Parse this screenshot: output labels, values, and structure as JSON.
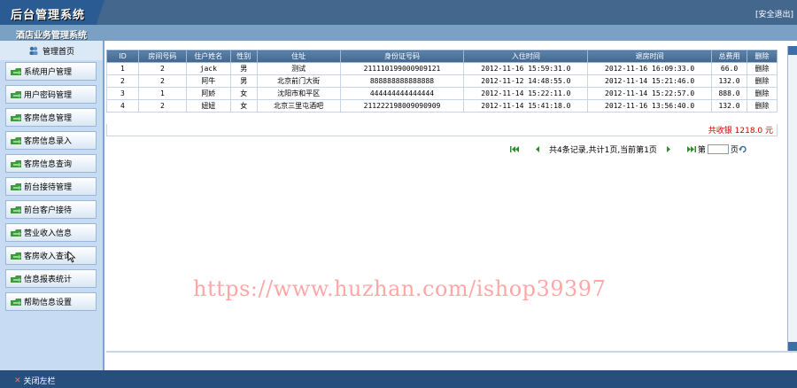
{
  "header": {
    "app_title": "后台管理系统",
    "logout": "[安全退出]",
    "subtitle": "酒店业务管理系统"
  },
  "sidebar": {
    "home": "管理首页",
    "items": [
      {
        "label": "系统用户管理"
      },
      {
        "label": "用户密码管理"
      },
      {
        "label": "客房信息管理"
      },
      {
        "label": "客房信息录入"
      },
      {
        "label": "客房信息查询"
      },
      {
        "label": "前台接待管理"
      },
      {
        "label": "前台客户接待"
      },
      {
        "label": "营业收入信息"
      },
      {
        "label": "客房收入查询"
      },
      {
        "label": "信息报表统计"
      },
      {
        "label": "帮助信息设置"
      }
    ]
  },
  "table": {
    "columns": [
      "ID",
      "房间号码",
      "住户姓名",
      "性别",
      "住址",
      "身份证号码",
      "入住时间",
      "退房时间",
      "总费用",
      "删除"
    ],
    "rows": [
      {
        "id": "1",
        "room": "2",
        "name": "jack",
        "gender": "男",
        "address": "测试",
        "idcard": "211110199000909121",
        "checkin": "2012-11-16 15:59:31.0",
        "checkout": "2012-11-16 16:09:33.0",
        "fee": "66.0",
        "action": "删除"
      },
      {
        "id": "2",
        "room": "2",
        "name": "阿牛",
        "gender": "男",
        "address": "北京前门大街",
        "idcard": "888888888888888",
        "checkin": "2012-11-12 14:48:55.0",
        "checkout": "2012-11-14 15:21:46.0",
        "fee": "132.0",
        "action": "删除"
      },
      {
        "id": "3",
        "room": "1",
        "name": "阿娇",
        "gender": "女",
        "address": "沈阳市和平区",
        "idcard": "444444444444444",
        "checkin": "2012-11-14 15:22:11.0",
        "checkout": "2012-11-14 15:22:57.0",
        "fee": "888.0",
        "action": "删除"
      },
      {
        "id": "4",
        "room": "2",
        "name": "妞妞",
        "gender": "女",
        "address": "北京三里屯酒吧",
        "idcard": "211222198009090909",
        "checkin": "2012-11-14 15:41:18.0",
        "checkout": "2012-11-16 13:56:40.0",
        "fee": "132.0",
        "action": "删除"
      }
    ],
    "total": "共收银 1218.0 元"
  },
  "pager": {
    "summary": "共4条记录,共计1页,当前第1页",
    "page_prefix": "第",
    "page_suffix": "页"
  },
  "footer": {
    "close_left": "关闭左栏"
  },
  "watermark": "https://www.huzhan.com/ishop39397",
  "colors": {
    "top_bar": "#44678e",
    "sub_bar": "#7aa0c4",
    "sidebar_bg": "#c7dcf2",
    "header_row": "#4d729b",
    "total_text": "#cc0000",
    "footer": "#274f7e"
  }
}
